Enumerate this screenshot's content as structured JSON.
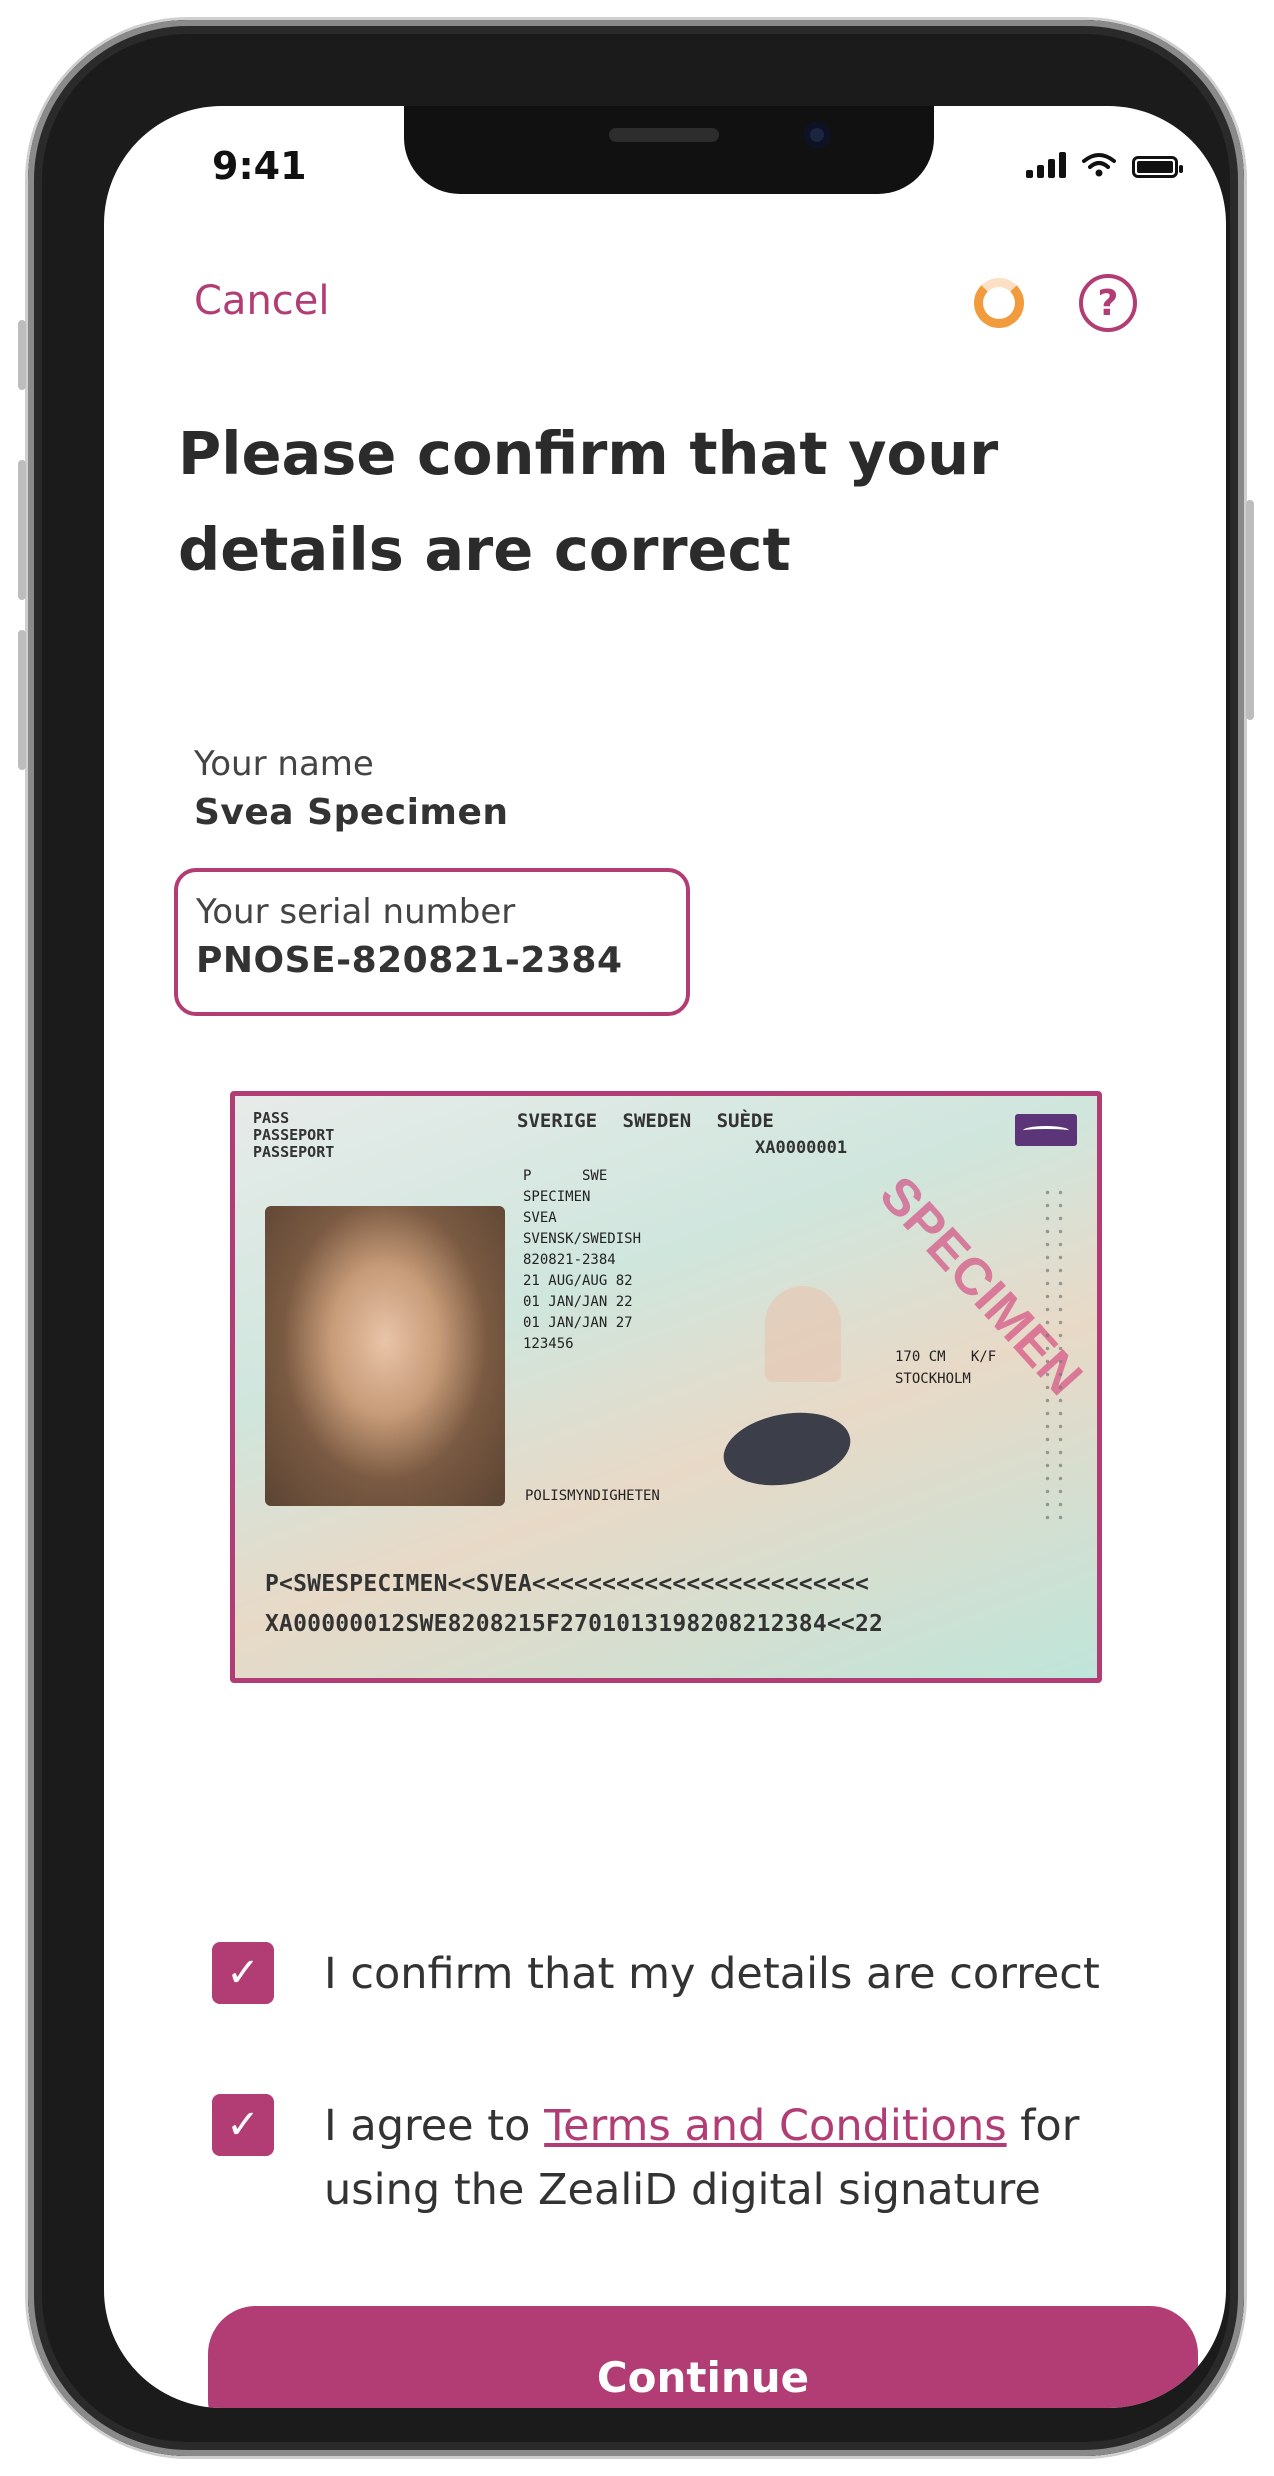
{
  "status_bar": {
    "time": "9:41"
  },
  "header": {
    "cancel_label": "Cancel",
    "help_symbol": "?"
  },
  "title": "Please confirm that your details are correct",
  "details": {
    "name_label": "Your name",
    "name_value": "Svea Specimen",
    "serial_label": "Your serial number",
    "serial_value": "PNOSE-820821-2384"
  },
  "passport": {
    "header_lines": "PASS\nPASSEPORT\nPASSEPORT",
    "country": "SVERIGE SWEDEN SUÈDE",
    "doc_number": "XA0000001",
    "fields": "P      SWE\nSPECIMEN\nSVEA\nSVENSK/SWEDISH\n820821-2384\n21 AUG/AUG 82\n01 JAN/JAN 22\n01 JAN/JAN 27\n123456",
    "stamp": "SPECIMEN",
    "height": "170 CM   K/F\nSTOCKHOLM",
    "authority": "POLISMYNDIGHETEN",
    "mrz_line1": "P<SWESPECIMEN<<SVEA<<<<<<<<<<<<<<<<<<<<<<<<",
    "mrz_line2": "XA00000012SWE8208215F2701013198208212384<<22"
  },
  "checks": [
    {
      "text": "I confirm that my details are correct",
      "checked": true
    },
    {
      "text_before": "I agree to ",
      "link_text": "Terms and Conditions",
      "text_after": " for using the ZealiD digital signature",
      "checked": true
    }
  ],
  "continue_label": "Continue",
  "colors": {
    "brand": "#b23c74",
    "spinner": "#f29b3d"
  }
}
